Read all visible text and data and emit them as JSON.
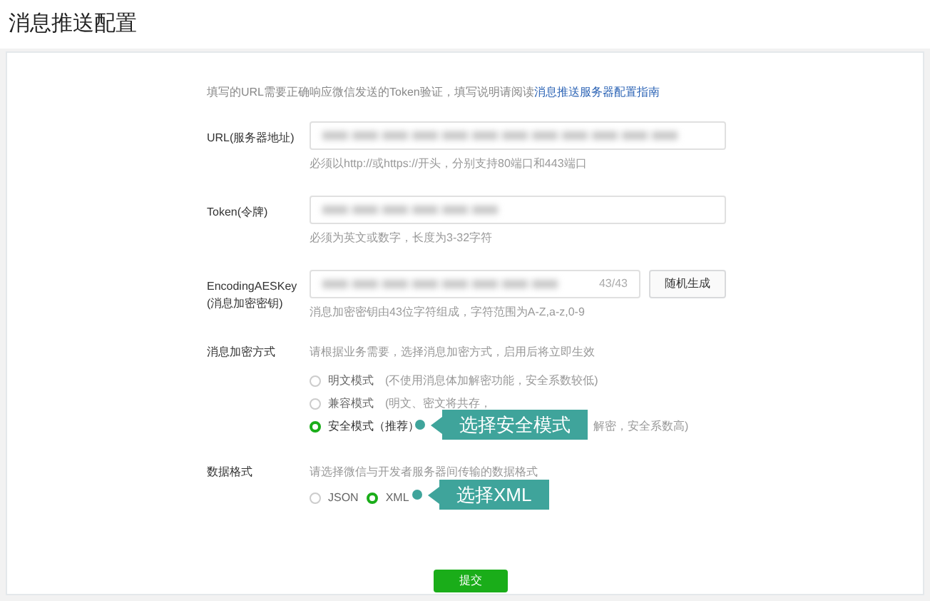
{
  "page_title": "消息推送配置",
  "intro": {
    "text": "填写的URL需要正确响应微信发送的Token验证，填写说明请阅读",
    "link": "消息推送服务器配置指南"
  },
  "fields": [
    {
      "label": "URL(服务器地址)",
      "hint": "必须以http://或https://开头，分别支持80端口和443端口",
      "kind": "wide"
    },
    {
      "label": "Token(令牌)",
      "hint": "必须为英文或数字，长度为3-32字符",
      "kind": "wide"
    },
    {
      "label": "EncodingAESKey",
      "label2": "(消息加密密钥)",
      "counter": "43/43",
      "button": "随机生成",
      "hint": "消息加密密钥由43位字符组成，字符范围为A-Z,a-z,0-9",
      "kind": "key"
    }
  ],
  "encryption": {
    "label": "消息加密方式",
    "hint": "请根据业务需要，选择消息加密方式，启用后将立即生效",
    "options": [
      {
        "label": "明文模式",
        "desc": "(不使用消息体加解密功能，安全系数较低)",
        "selected": false
      },
      {
        "label": "兼容模式",
        "desc": "(明文、密文将共存，",
        "selected": false
      },
      {
        "label": "安全模式（推荐）",
        "desc": "解密，安全系数高)",
        "selected": true
      }
    ],
    "callout": "选择安全模式"
  },
  "format": {
    "label": "数据格式",
    "hint": "请选择微信与开发者服务器间传输的数据格式",
    "options": [
      {
        "label": "JSON",
        "selected": false
      },
      {
        "label": "XML",
        "selected": true
      }
    ],
    "callout": "选择XML"
  },
  "submit": "提交"
}
